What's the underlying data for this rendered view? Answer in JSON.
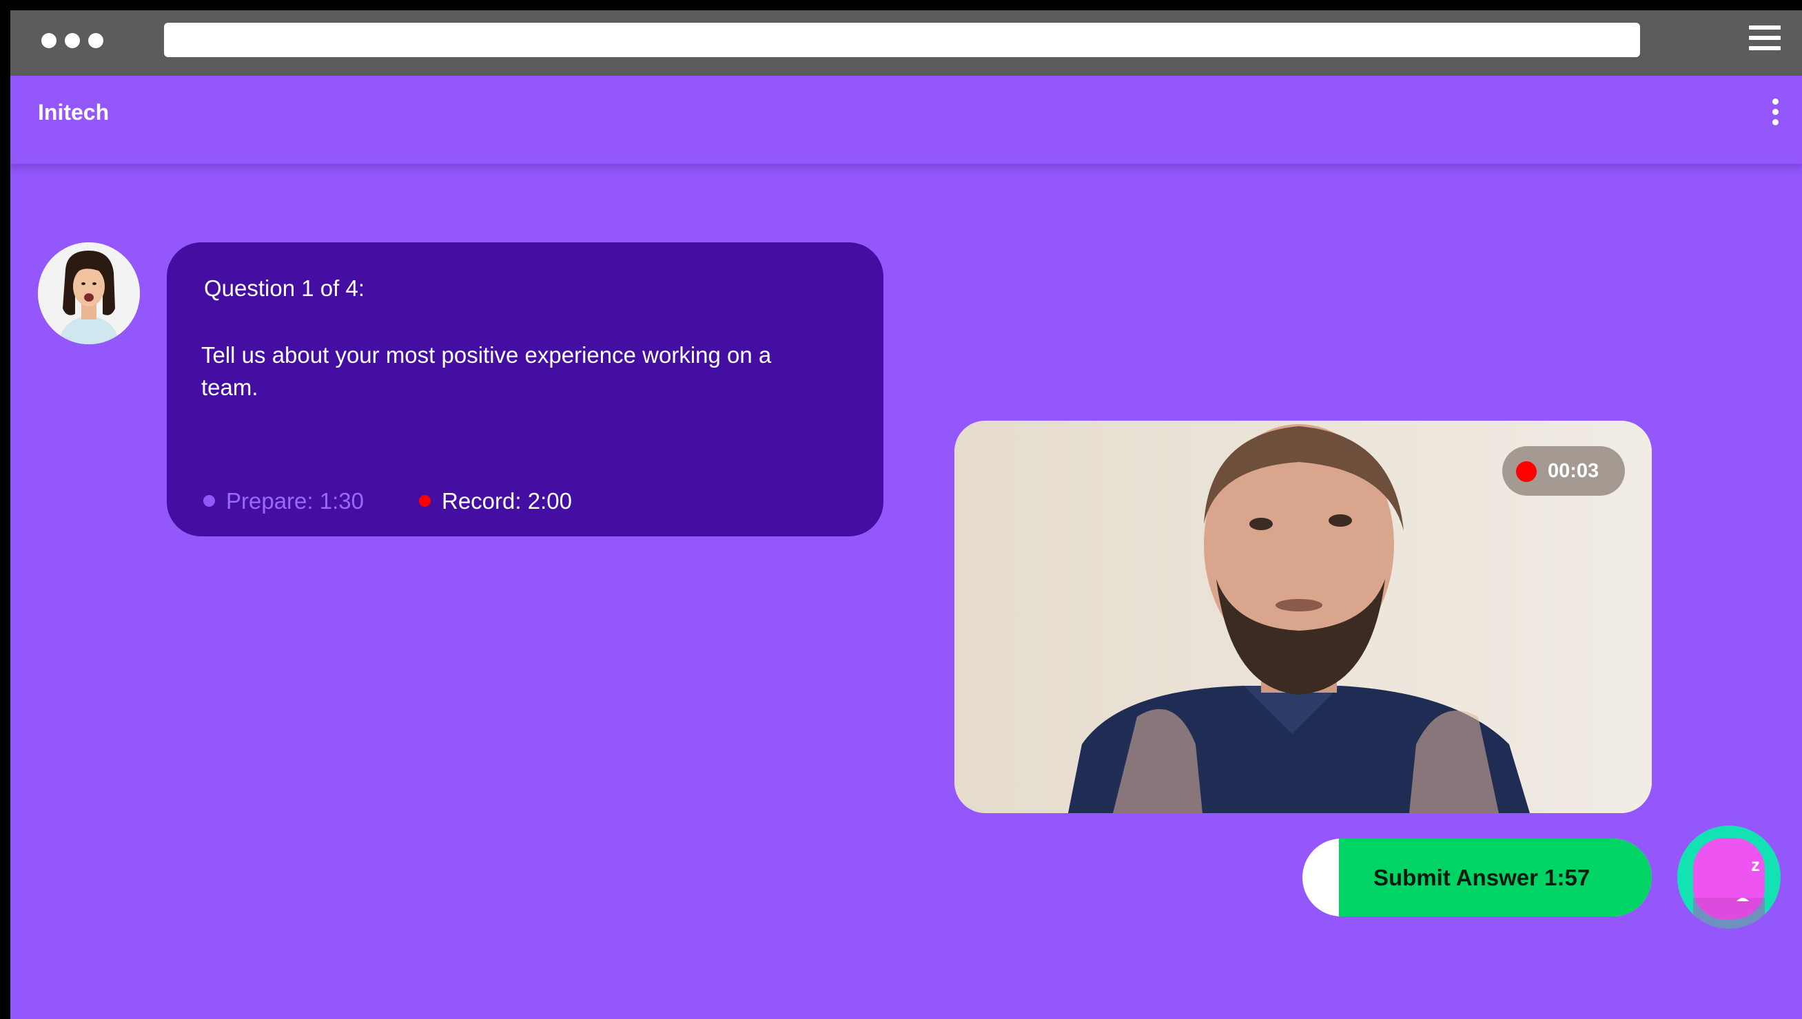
{
  "app": {
    "brand": "Initech"
  },
  "question": {
    "counter": "Question 1 of 4:",
    "text": "Tell us about your most positive experience working on a team.",
    "prepare_label": "Prepare: 1:30",
    "record_label": "Record: 2:00"
  },
  "video": {
    "elapsed": "00:03"
  },
  "actions": {
    "submit_label": "Submit Answer 1:57"
  },
  "bot": {
    "sleep_glyph": "z"
  },
  "colors": {
    "background": "#9457fb",
    "card": "#440ea3",
    "accent_green": "#00d465",
    "record_red": "#ff0000",
    "prepare_dot": "#9457fb",
    "bot_ring": "#13e2b3",
    "bot_body": "#ee54f0"
  },
  "icons": {
    "window_controls": "three-dots",
    "menu": "hamburger-icon",
    "more": "vertical-dots-icon",
    "recording": "red-dot-icon"
  }
}
